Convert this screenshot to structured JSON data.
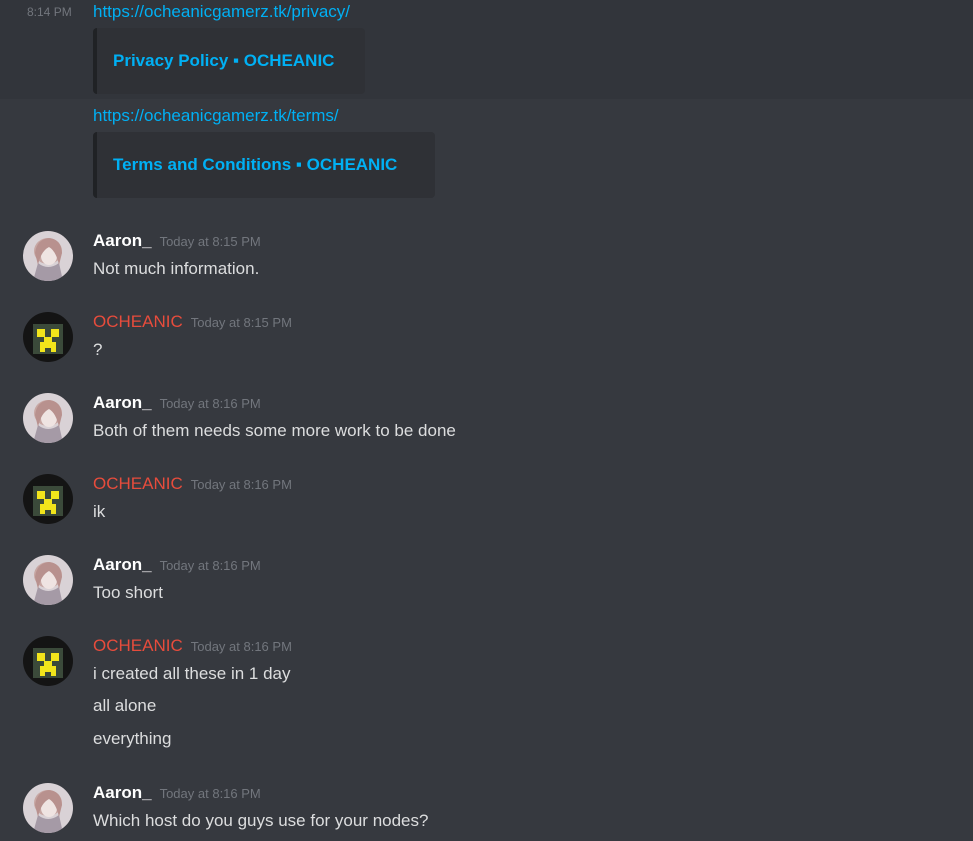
{
  "top_group": {
    "timestamp": "8:14 PM",
    "link1": "https://ocheanicgamerz.tk/privacy/",
    "embed1_title": "Privacy Policy ▪ OCHEANIC",
    "link2": "https://ocheanicgamerz.tk/terms/",
    "embed2_title": "Terms and Conditions ▪ OCHEANIC"
  },
  "messages": [
    {
      "author": "Aaron_",
      "time": "Today at 8:15 PM",
      "lines": [
        "Not much information."
      ]
    },
    {
      "author": "OCHEANIC",
      "time": "Today at 8:15 PM",
      "lines": [
        "?"
      ]
    },
    {
      "author": "Aaron_",
      "time": "Today at 8:16 PM",
      "lines": [
        "Both of them needs some more work to be done"
      ]
    },
    {
      "author": "OCHEANIC",
      "time": "Today at 8:16 PM",
      "lines": [
        "ik"
      ]
    },
    {
      "author": "Aaron_",
      "time": "Today at 8:16 PM",
      "lines": [
        "Too short"
      ]
    },
    {
      "author": "OCHEANIC",
      "time": "Today at 8:16 PM",
      "lines": [
        "i created all these in 1 day",
        "all alone",
        "everything"
      ]
    },
    {
      "author": "Aaron_",
      "time": "Today at 8:16 PM",
      "lines": [
        "Which host do you guys use for your nodes?"
      ]
    }
  ],
  "colors": {
    "background": "#36393f",
    "link": "#00b0f4",
    "ocheanic_name": "#e74c3c",
    "timestamp": "#72767d"
  },
  "icons": {
    "aaron_avatar": "anime-girl-avatar",
    "ocheanic_avatar": "creeper-face-avatar"
  }
}
